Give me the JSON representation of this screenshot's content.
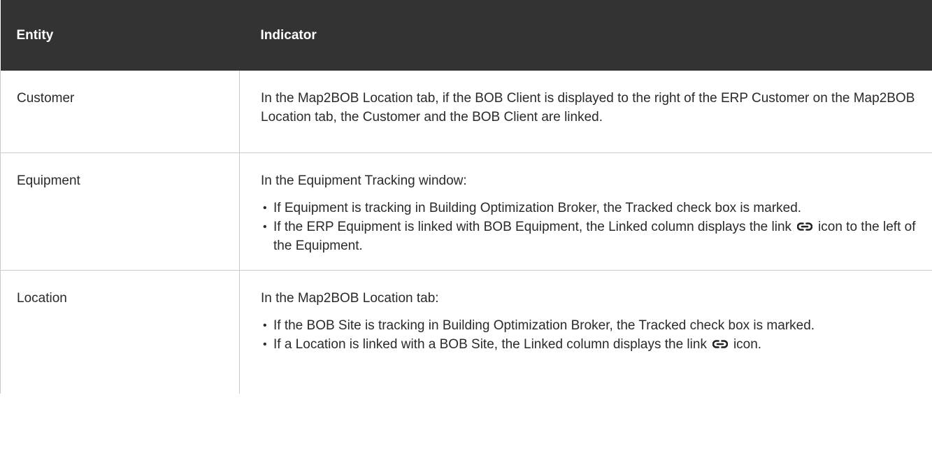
{
  "header": {
    "col1": "Entity",
    "col2": "Indicator"
  },
  "rows": [
    {
      "entity": "Customer",
      "text": "In the Map2BOB Location tab, if the BOB Client is displayed to the right of the ERP Customer on the Map2BOB Location tab, the Customer and the BOB Client are linked."
    },
    {
      "entity": "Equipment",
      "intro": "In the Equipment Tracking window:",
      "bullets": [
        {
          "text": "If Equipment is tracking in Building Optimization Broker, the Tracked check box is marked."
        },
        {
          "before": "If the ERP Equipment is linked with BOB Equipment, the Linked column displays the link",
          "after": "icon to the left of the Equipment."
        }
      ]
    },
    {
      "entity": "Location",
      "intro": "In the Map2BOB Location tab:",
      "bullets": [
        {
          "text": "If the BOB Site is tracking in Building Optimization Broker, the Tracked check box is marked."
        },
        {
          "before": "If a Location is linked with a BOB Site, the Linked column displays the link",
          "after": "icon."
        }
      ]
    }
  ],
  "icons": {
    "link": "link-icon"
  },
  "colors": {
    "header_bg": "#333333",
    "header_text": "#ffffff",
    "border": "#c9c9c9"
  }
}
